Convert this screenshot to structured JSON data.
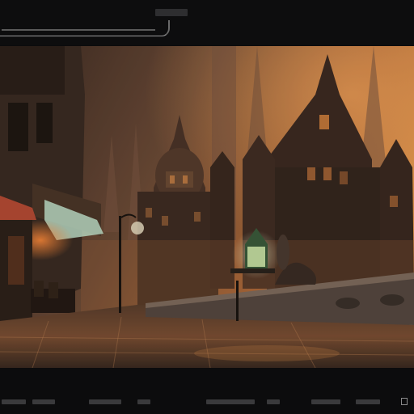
{
  "window": {
    "title": "",
    "field_value": "",
    "caption": ""
  },
  "image": {
    "subject": "fantasy-gothic-city-street",
    "palette": {
      "sky_glow": "#d9843f",
      "haze": "#8a5a3c",
      "shadow": "#1e1510",
      "stone": "#5e4a3d",
      "lamp": "#e6f0c8",
      "awning": "#cfe8d6",
      "cobble_highlight": "#c2794a"
    }
  },
  "icons": {
    "corner": "expand-icon"
  }
}
